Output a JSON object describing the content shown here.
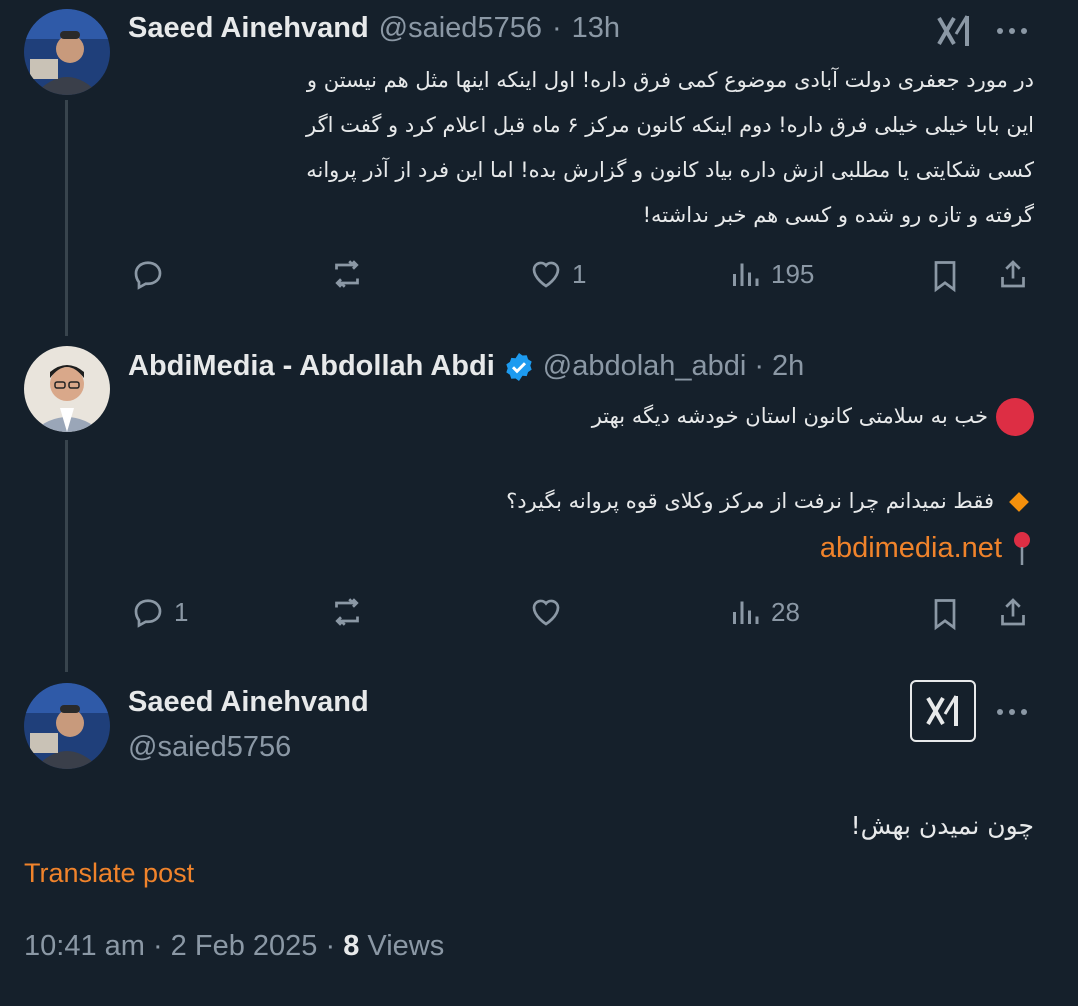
{
  "posts": [
    {
      "author": "Saeed Ainehvand",
      "handle": "@saied5756",
      "sep": "·",
      "time": "13h",
      "lines": [
        "در مورد جعفری دولت آبادی موضوع کمی فرق داره! اول اینکه  اینها مثل هم نیستن و",
        "این بابا خیلی خیلی فرق داره! دوم اینکه کانون مرکز ۶ ماه قبل اعلام کرد و گفت اگر",
        "کسی شکایتی یا مطلبی ازش داره بیاد کانون و گزارش بده! اما این فرد از آذر  پروانه",
        "گرفته و تازه رو شده و کسی هم خبر نداشته!"
      ],
      "stats": {
        "replies": "",
        "reposts": "",
        "likes": "1",
        "views": "195"
      }
    },
    {
      "author": "AbdiMedia - Abdollah Abdi",
      "handle": "@abdolah_abdi",
      "sep": "·",
      "time": "2h",
      "line1": "خب به سلامتی کانون استان خودشه دیگه بهتر",
      "line2": "فقط نمیدانم چرا نرفت از مرکز وکلای قوه پروانه بگیرد؟",
      "link": "abdimedia.net",
      "stats": {
        "replies": "1",
        "reposts": "",
        "likes": "",
        "views": "28"
      }
    }
  ],
  "main_post": {
    "author": "Saeed Ainehvand",
    "handle": "@saied5756",
    "text": "چون نمیدن بهش!",
    "translate": "Translate post",
    "timestamp": "10:41 am · 2 Feb 2025 · ",
    "views_count": "8",
    "views_label": " Views"
  },
  "colors": {
    "background": "#15202b",
    "text": "#e7e9ea",
    "muted": "#8b98a5",
    "accent_orange": "#f0832b",
    "verified_blue": "#1d9bf0"
  },
  "icons": [
    "reply-icon",
    "repost-icon",
    "like-icon",
    "views-icon",
    "bookmark-icon",
    "share-icon",
    "grok-icon",
    "more-icon",
    "verified-icon",
    "red-circle-icon",
    "orange-diamond-icon",
    "pin-icon"
  ]
}
